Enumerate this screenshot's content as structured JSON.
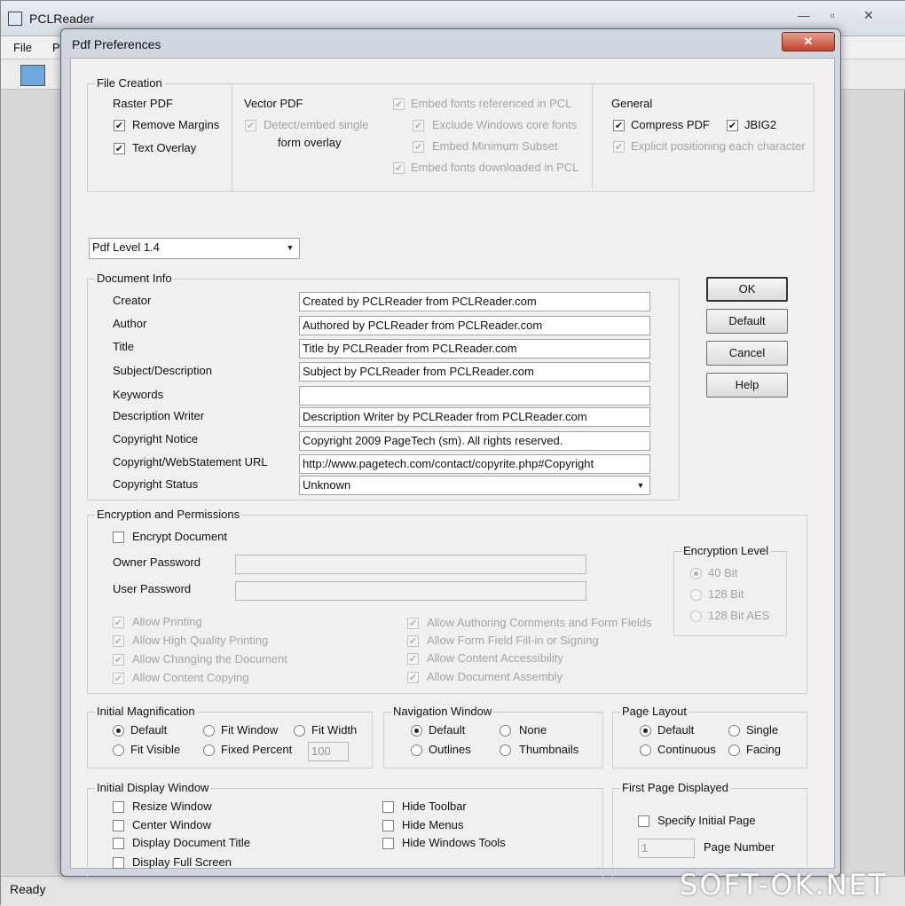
{
  "main_window": {
    "title": "PCLReader",
    "menu": [
      "File",
      "P"
    ],
    "status": "Ready",
    "controls": {
      "minimize": "—",
      "maximize": "▫",
      "close": "✕"
    }
  },
  "dialog": {
    "title": "Pdf Preferences",
    "close": "✕",
    "file_creation": {
      "legend": "File Creation",
      "raster": {
        "title": "Raster PDF",
        "remove_margins": "Remove Margins",
        "text_overlay": "Text Overlay"
      },
      "vector": {
        "title": "Vector PDF",
        "detect_1": "Detect/embed single",
        "detect_2": "form overlay",
        "embed_fonts": "Embed fonts referenced in PCL",
        "exclude": "Exclude Windows core fonts",
        "min_subset": "Embed Minimum Subset",
        "downloaded": "Embed fonts downloaded in PCL"
      },
      "general": {
        "title": "General",
        "compress": "Compress PDF",
        "jbig2": "JBIG2",
        "explicit": "Explicit positioning each character"
      }
    },
    "pdf_level": "Pdf Level 1.4",
    "doc_info": {
      "legend": "Document Info",
      "fields": [
        {
          "label": "Creator",
          "value": "Created by PCLReader from PCLReader.com"
        },
        {
          "label": "Author",
          "value": "Authored by PCLReader from PCLReader.com"
        },
        {
          "label": "Title",
          "value": "Title by PCLReader from PCLReader.com"
        },
        {
          "label": "Subject/Description",
          "value": "Subject by PCLReader from PCLReader.com"
        },
        {
          "label": "Keywords",
          "value": ""
        },
        {
          "label": "Description Writer",
          "value": "Description Writer by PCLReader from PCLReader.com"
        },
        {
          "label": "Copyright Notice",
          "value": "Copyright 2009 PageTech (sm).  All rights reserved."
        },
        {
          "label": "Copyright/WebStatement URL",
          "value": "http://www.pagetech.com/contact/copyrite.php#Copyright"
        },
        {
          "label": "Copyright Status",
          "value": "Unknown"
        }
      ]
    },
    "buttons": {
      "ok": "OK",
      "default": "Default",
      "cancel": "Cancel",
      "help": "Help"
    },
    "encryption": {
      "legend": "Encryption and Permissions",
      "encrypt": "Encrypt Document",
      "owner_pw": "Owner Password",
      "user_pw": "User Password",
      "level": {
        "legend": "Encryption Level",
        "bit40": "40 Bit",
        "bit128": "128 Bit",
        "aes128": "128 Bit AES"
      },
      "perms_left": [
        "Allow Printing",
        "Allow High Quality Printing",
        "Allow Changing the Document",
        "Allow Content Copying"
      ],
      "perms_right": [
        "Allow Authoring Comments and Form Fields",
        "Allow Form Field Fill-in or Signing",
        "Allow Content Accessibility",
        "Allow Document Assembly"
      ]
    },
    "magnification": {
      "legend": "Initial Magnification",
      "default": "Default",
      "fit_window": "Fit Window",
      "fit_width": "Fit Width",
      "fit_visible": "Fit Visible",
      "fixed_percent": "Fixed Percent",
      "percent_value": "100"
    },
    "navigation": {
      "legend": "Navigation Window",
      "default": "Default",
      "none": "None",
      "outlines": "Outlines",
      "thumbnails": "Thumbnails"
    },
    "page_layout": {
      "legend": "Page Layout",
      "default": "Default",
      "single": "Single",
      "continuous": "Continuous",
      "facing": "Facing"
    },
    "display_window": {
      "legend": "Initial Display Window",
      "resize": "Resize Window",
      "center": "Center Window",
      "doc_title": "Display Document Title",
      "full_screen": "Display Full Screen",
      "hide_toolbar": "Hide Toolbar",
      "hide_menus": "Hide Menus",
      "hide_tools": "Hide Windows Tools"
    },
    "first_page": {
      "legend": "First Page Displayed",
      "specify": "Specify Initial Page",
      "page_value": "1",
      "page_number": "Page Number"
    }
  },
  "watermark": "SOFT-OK.NET"
}
